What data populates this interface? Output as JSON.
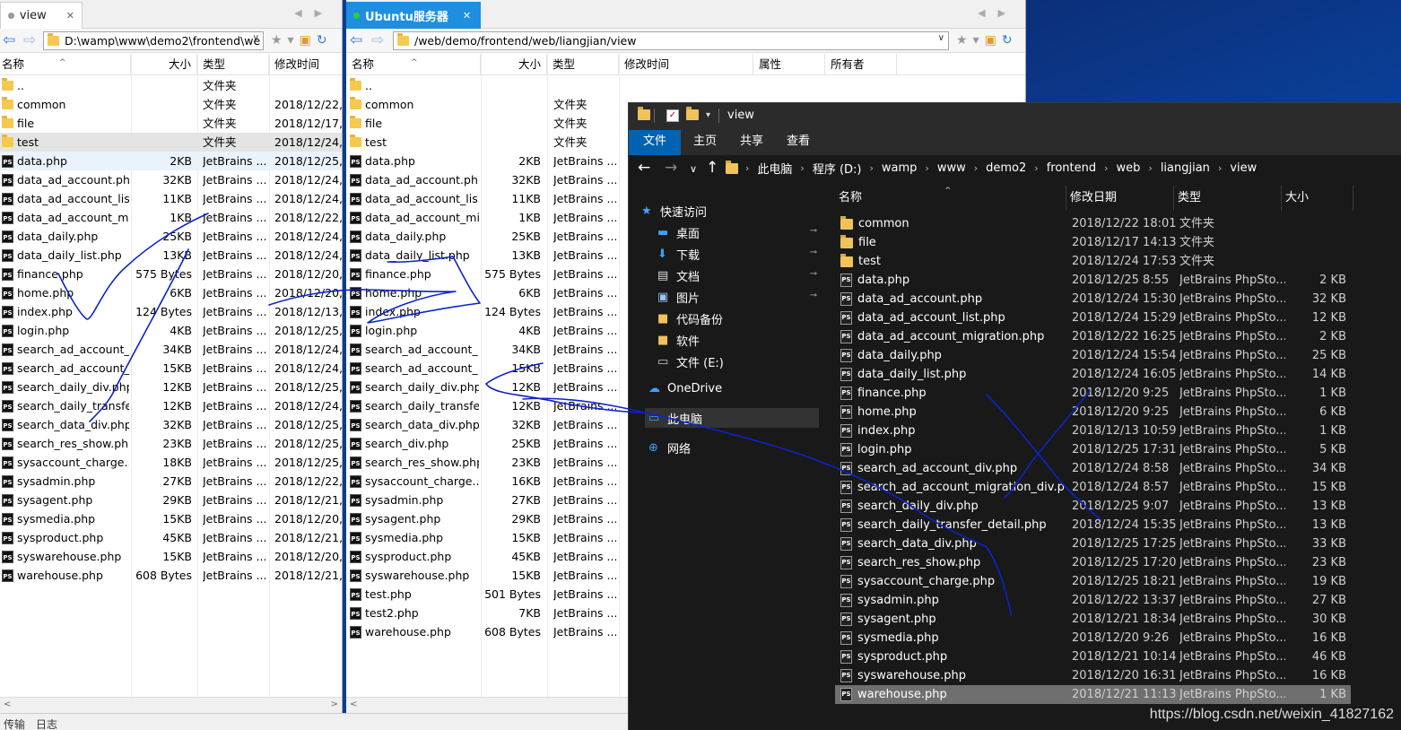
{
  "left_pane": {
    "tab_label": "view",
    "address": "D:\\wamp\\www\\demo2\\frontend\\we",
    "columns": [
      "名称",
      "大小",
      "类型",
      "修改时间"
    ],
    "rows": [
      {
        "name": "..",
        "size": "",
        "type": "文件夹",
        "date": "",
        "kind": "folder"
      },
      {
        "name": "common",
        "size": "",
        "type": "文件夹",
        "date": "2018/12/22,",
        "kind": "folder"
      },
      {
        "name": "file",
        "size": "",
        "type": "文件夹",
        "date": "2018/12/17,",
        "kind": "folder"
      },
      {
        "name": "test",
        "size": "",
        "type": "文件夹",
        "date": "2018/12/24,",
        "kind": "folder"
      },
      {
        "name": "data.php",
        "size": "2KB",
        "type": "JetBrains ...",
        "date": "2018/12/25,",
        "kind": "php"
      },
      {
        "name": "data_ad_account.php",
        "size": "32KB",
        "type": "JetBrains ...",
        "date": "2018/12/24,",
        "kind": "php"
      },
      {
        "name": "data_ad_account_lis...",
        "size": "11KB",
        "type": "JetBrains ...",
        "date": "2018/12/24,",
        "kind": "php"
      },
      {
        "name": "data_ad_account_mi...",
        "size": "1KB",
        "type": "JetBrains ...",
        "date": "2018/12/22,",
        "kind": "php"
      },
      {
        "name": "data_daily.php",
        "size": "25KB",
        "type": "JetBrains ...",
        "date": "2018/12/24,",
        "kind": "php"
      },
      {
        "name": "data_daily_list.php",
        "size": "13KB",
        "type": "JetBrains ...",
        "date": "2018/12/24,",
        "kind": "php"
      },
      {
        "name": "finance.php",
        "size": "575 Bytes",
        "type": "JetBrains ...",
        "date": "2018/12/20,",
        "kind": "php"
      },
      {
        "name": "home.php",
        "size": "6KB",
        "type": "JetBrains ...",
        "date": "2018/12/20,",
        "kind": "php"
      },
      {
        "name": "index.php",
        "size": "124 Bytes",
        "type": "JetBrains ...",
        "date": "2018/12/13,",
        "kind": "php"
      },
      {
        "name": "login.php",
        "size": "4KB",
        "type": "JetBrains ...",
        "date": "2018/12/25,",
        "kind": "php"
      },
      {
        "name": "search_ad_account_...",
        "size": "34KB",
        "type": "JetBrains ...",
        "date": "2018/12/24,",
        "kind": "php"
      },
      {
        "name": "search_ad_account_...",
        "size": "15KB",
        "type": "JetBrains ...",
        "date": "2018/12/24,",
        "kind": "php"
      },
      {
        "name": "search_daily_div.php",
        "size": "12KB",
        "type": "JetBrains ...",
        "date": "2018/12/25,",
        "kind": "php"
      },
      {
        "name": "search_daily_transfe...",
        "size": "12KB",
        "type": "JetBrains ...",
        "date": "2018/12/24,",
        "kind": "php"
      },
      {
        "name": "search_data_div.php",
        "size": "32KB",
        "type": "JetBrains ...",
        "date": "2018/12/25,",
        "kind": "php"
      },
      {
        "name": "search_res_show.php",
        "size": "23KB",
        "type": "JetBrains ...",
        "date": "2018/12/25,",
        "kind": "php"
      },
      {
        "name": "sysaccount_charge....",
        "size": "18KB",
        "type": "JetBrains ...",
        "date": "2018/12/25,",
        "kind": "php"
      },
      {
        "name": "sysadmin.php",
        "size": "27KB",
        "type": "JetBrains ...",
        "date": "2018/12/22,",
        "kind": "php"
      },
      {
        "name": "sysagent.php",
        "size": "29KB",
        "type": "JetBrains ...",
        "date": "2018/12/21,",
        "kind": "php"
      },
      {
        "name": "sysmedia.php",
        "size": "15KB",
        "type": "JetBrains ...",
        "date": "2018/12/20,",
        "kind": "php"
      },
      {
        "name": "sysproduct.php",
        "size": "45KB",
        "type": "JetBrains ...",
        "date": "2018/12/21,",
        "kind": "php"
      },
      {
        "name": "syswarehouse.php",
        "size": "15KB",
        "type": "JetBrains ...",
        "date": "2018/12/20,",
        "kind": "php"
      },
      {
        "name": "warehouse.php",
        "size": "608 Bytes",
        "type": "JetBrains ...",
        "date": "2018/12/21,",
        "kind": "php"
      }
    ]
  },
  "middle_pane": {
    "tab_label": "Ubuntu服务器",
    "address": "/web/demo/frontend/web/liangjian/view",
    "columns": [
      "名称",
      "大小",
      "类型",
      "修改时间",
      "属性",
      "所有者"
    ],
    "rows": [
      {
        "name": "..",
        "size": "",
        "type": "",
        "kind": "folder"
      },
      {
        "name": "common",
        "size": "",
        "type": "文件夹",
        "kind": "folder"
      },
      {
        "name": "file",
        "size": "",
        "type": "文件夹",
        "kind": "folder"
      },
      {
        "name": "test",
        "size": "",
        "type": "文件夹",
        "kind": "folder"
      },
      {
        "name": "data.php",
        "size": "2KB",
        "type": "JetBrains ...",
        "kind": "php"
      },
      {
        "name": "data_ad_account.php",
        "size": "32KB",
        "type": "JetBrains ...",
        "kind": "php"
      },
      {
        "name": "data_ad_account_lis...",
        "size": "11KB",
        "type": "JetBrains ...",
        "kind": "php"
      },
      {
        "name": "data_ad_account_mi...",
        "size": "1KB",
        "type": "JetBrains ...",
        "kind": "php"
      },
      {
        "name": "data_daily.php",
        "size": "25KB",
        "type": "JetBrains ...",
        "kind": "php"
      },
      {
        "name": "data_daily_list.php",
        "size": "13KB",
        "type": "JetBrains ...",
        "kind": "php"
      },
      {
        "name": "finance.php",
        "size": "575 Bytes",
        "type": "JetBrains ...",
        "kind": "php"
      },
      {
        "name": "home.php",
        "size": "6KB",
        "type": "JetBrains ...",
        "kind": "php"
      },
      {
        "name": "index.php",
        "size": "124 Bytes",
        "type": "JetBrains ...",
        "kind": "php"
      },
      {
        "name": "login.php",
        "size": "4KB",
        "type": "JetBrains ...",
        "kind": "php"
      },
      {
        "name": "search_ad_account_...",
        "size": "34KB",
        "type": "JetBrains ...",
        "kind": "php"
      },
      {
        "name": "search_ad_account_...",
        "size": "15KB",
        "type": "JetBrains ...",
        "kind": "php"
      },
      {
        "name": "search_daily_div.php",
        "size": "12KB",
        "type": "JetBrains ...",
        "kind": "php"
      },
      {
        "name": "search_daily_transfe...",
        "size": "12KB",
        "type": "JetBrains ...",
        "kind": "php"
      },
      {
        "name": "search_data_div.php",
        "size": "32KB",
        "type": "JetBrains ...",
        "kind": "php"
      },
      {
        "name": "search_div.php",
        "size": "25KB",
        "type": "JetBrains ...",
        "kind": "php"
      },
      {
        "name": "search_res_show.php",
        "size": "23KB",
        "type": "JetBrains ...",
        "kind": "php"
      },
      {
        "name": "sysaccount_charge....",
        "size": "16KB",
        "type": "JetBrains ...",
        "kind": "php"
      },
      {
        "name": "sysadmin.php",
        "size": "27KB",
        "type": "JetBrains ...",
        "kind": "php"
      },
      {
        "name": "sysagent.php",
        "size": "29KB",
        "type": "JetBrains ...",
        "kind": "php"
      },
      {
        "name": "sysmedia.php",
        "size": "15KB",
        "type": "JetBrains ...",
        "kind": "php"
      },
      {
        "name": "sysproduct.php",
        "size": "45KB",
        "type": "JetBrains ...",
        "kind": "php"
      },
      {
        "name": "syswarehouse.php",
        "size": "15KB",
        "type": "JetBrains ...",
        "kind": "php"
      },
      {
        "name": "test.php",
        "size": "501 Bytes",
        "type": "JetBrains ...",
        "kind": "php"
      },
      {
        "name": "test2.php",
        "size": "7KB",
        "type": "JetBrains ...",
        "kind": "php"
      },
      {
        "name": "warehouse.php",
        "size": "608 Bytes",
        "type": "JetBrains ...",
        "kind": "php"
      }
    ]
  },
  "bottom_tabs": [
    "传输",
    "日志"
  ],
  "explorer": {
    "title": "view",
    "ribbon_tabs": [
      "文件",
      "主页",
      "共享",
      "查看"
    ],
    "breadcrumb": [
      "此电脑",
      "程序 (D:)",
      "wamp",
      "www",
      "demo2",
      "frontend",
      "web",
      "liangjian",
      "view"
    ],
    "nav_items": [
      {
        "label": "快速访问",
        "icon": "star-icon"
      },
      {
        "label": "桌面",
        "icon": "desktop-icon"
      },
      {
        "label": "下载",
        "icon": "download-icon"
      },
      {
        "label": "文档",
        "icon": "document-icon"
      },
      {
        "label": "图片",
        "icon": "picture-icon"
      },
      {
        "label": "代码备份",
        "icon": "folder-icon"
      },
      {
        "label": "软件",
        "icon": "folder-icon"
      },
      {
        "label": "文件 (E:)",
        "icon": "drive-icon"
      },
      {
        "label": "OneDrive",
        "icon": "cloud-icon"
      },
      {
        "label": "此电脑",
        "icon": "computer-icon"
      },
      {
        "label": "网络",
        "icon": "network-icon"
      }
    ],
    "columns": [
      "名称",
      "修改日期",
      "类型",
      "大小"
    ],
    "rows": [
      {
        "name": "common",
        "date": "2018/12/22 18:01",
        "type": "文件夹",
        "size": "",
        "kind": "folder"
      },
      {
        "name": "file",
        "date": "2018/12/17 14:13",
        "type": "文件夹",
        "size": "",
        "kind": "folder"
      },
      {
        "name": "test",
        "date": "2018/12/24 17:53",
        "type": "文件夹",
        "size": "",
        "kind": "folder"
      },
      {
        "name": "data.php",
        "date": "2018/12/25 8:55",
        "type": "JetBrains PhpSto...",
        "size": "2 KB",
        "kind": "php"
      },
      {
        "name": "data_ad_account.php",
        "date": "2018/12/24 15:30",
        "type": "JetBrains PhpSto...",
        "size": "32 KB",
        "kind": "php"
      },
      {
        "name": "data_ad_account_list.php",
        "date": "2018/12/24 15:29",
        "type": "JetBrains PhpSto...",
        "size": "12 KB",
        "kind": "php"
      },
      {
        "name": "data_ad_account_migration.php",
        "date": "2018/12/22 16:25",
        "type": "JetBrains PhpSto...",
        "size": "2 KB",
        "kind": "php"
      },
      {
        "name": "data_daily.php",
        "date": "2018/12/24 15:54",
        "type": "JetBrains PhpSto...",
        "size": "25 KB",
        "kind": "php"
      },
      {
        "name": "data_daily_list.php",
        "date": "2018/12/24 16:05",
        "type": "JetBrains PhpSto...",
        "size": "14 KB",
        "kind": "php"
      },
      {
        "name": "finance.php",
        "date": "2018/12/20 9:25",
        "type": "JetBrains PhpSto...",
        "size": "1 KB",
        "kind": "php"
      },
      {
        "name": "home.php",
        "date": "2018/12/20 9:25",
        "type": "JetBrains PhpSto...",
        "size": "6 KB",
        "kind": "php"
      },
      {
        "name": "index.php",
        "date": "2018/12/13 10:59",
        "type": "JetBrains PhpSto...",
        "size": "1 KB",
        "kind": "php"
      },
      {
        "name": "login.php",
        "date": "2018/12/25 17:31",
        "type": "JetBrains PhpSto...",
        "size": "5 KB",
        "kind": "php"
      },
      {
        "name": "search_ad_account_div.php",
        "date": "2018/12/24 8:58",
        "type": "JetBrains PhpSto...",
        "size": "34 KB",
        "kind": "php"
      },
      {
        "name": "search_ad_account_migration_div.php",
        "date": "2018/12/24 8:57",
        "type": "JetBrains PhpSto...",
        "size": "15 KB",
        "kind": "php"
      },
      {
        "name": "search_daily_div.php",
        "date": "2018/12/25 9:07",
        "type": "JetBrains PhpSto...",
        "size": "13 KB",
        "kind": "php"
      },
      {
        "name": "search_daily_transfer_detail.php",
        "date": "2018/12/24 15:35",
        "type": "JetBrains PhpSto...",
        "size": "13 KB",
        "kind": "php"
      },
      {
        "name": "search_data_div.php",
        "date": "2018/12/25 17:25",
        "type": "JetBrains PhpSto...",
        "size": "33 KB",
        "kind": "php"
      },
      {
        "name": "search_res_show.php",
        "date": "2018/12/25 17:20",
        "type": "JetBrains PhpSto...",
        "size": "23 KB",
        "kind": "php"
      },
      {
        "name": "sysaccount_charge.php",
        "date": "2018/12/25 18:21",
        "type": "JetBrains PhpSto...",
        "size": "19 KB",
        "kind": "php"
      },
      {
        "name": "sysadmin.php",
        "date": "2018/12/22 13:37",
        "type": "JetBrains PhpSto...",
        "size": "27 KB",
        "kind": "php"
      },
      {
        "name": "sysagent.php",
        "date": "2018/12/21 18:34",
        "type": "JetBrains PhpSto...",
        "size": "30 KB",
        "kind": "php"
      },
      {
        "name": "sysmedia.php",
        "date": "2018/12/20 9:26",
        "type": "JetBrains PhpSto...",
        "size": "16 KB",
        "kind": "php"
      },
      {
        "name": "sysproduct.php",
        "date": "2018/12/21 10:14",
        "type": "JetBrains PhpSto...",
        "size": "46 KB",
        "kind": "php"
      },
      {
        "name": "syswarehouse.php",
        "date": "2018/12/20 16:31",
        "type": "JetBrains PhpSto...",
        "size": "16 KB",
        "kind": "php"
      },
      {
        "name": "warehouse.php",
        "date": "2018/12/21 11:13",
        "type": "JetBrains PhpSto...",
        "size": "1 KB",
        "kind": "php"
      }
    ]
  },
  "watermark": "https://blog.csdn.net/weixin_41827162",
  "colors": {
    "accent": "#1e8fe0",
    "ribbon_file": "#0063b1",
    "scribble": "#0b24c8"
  }
}
